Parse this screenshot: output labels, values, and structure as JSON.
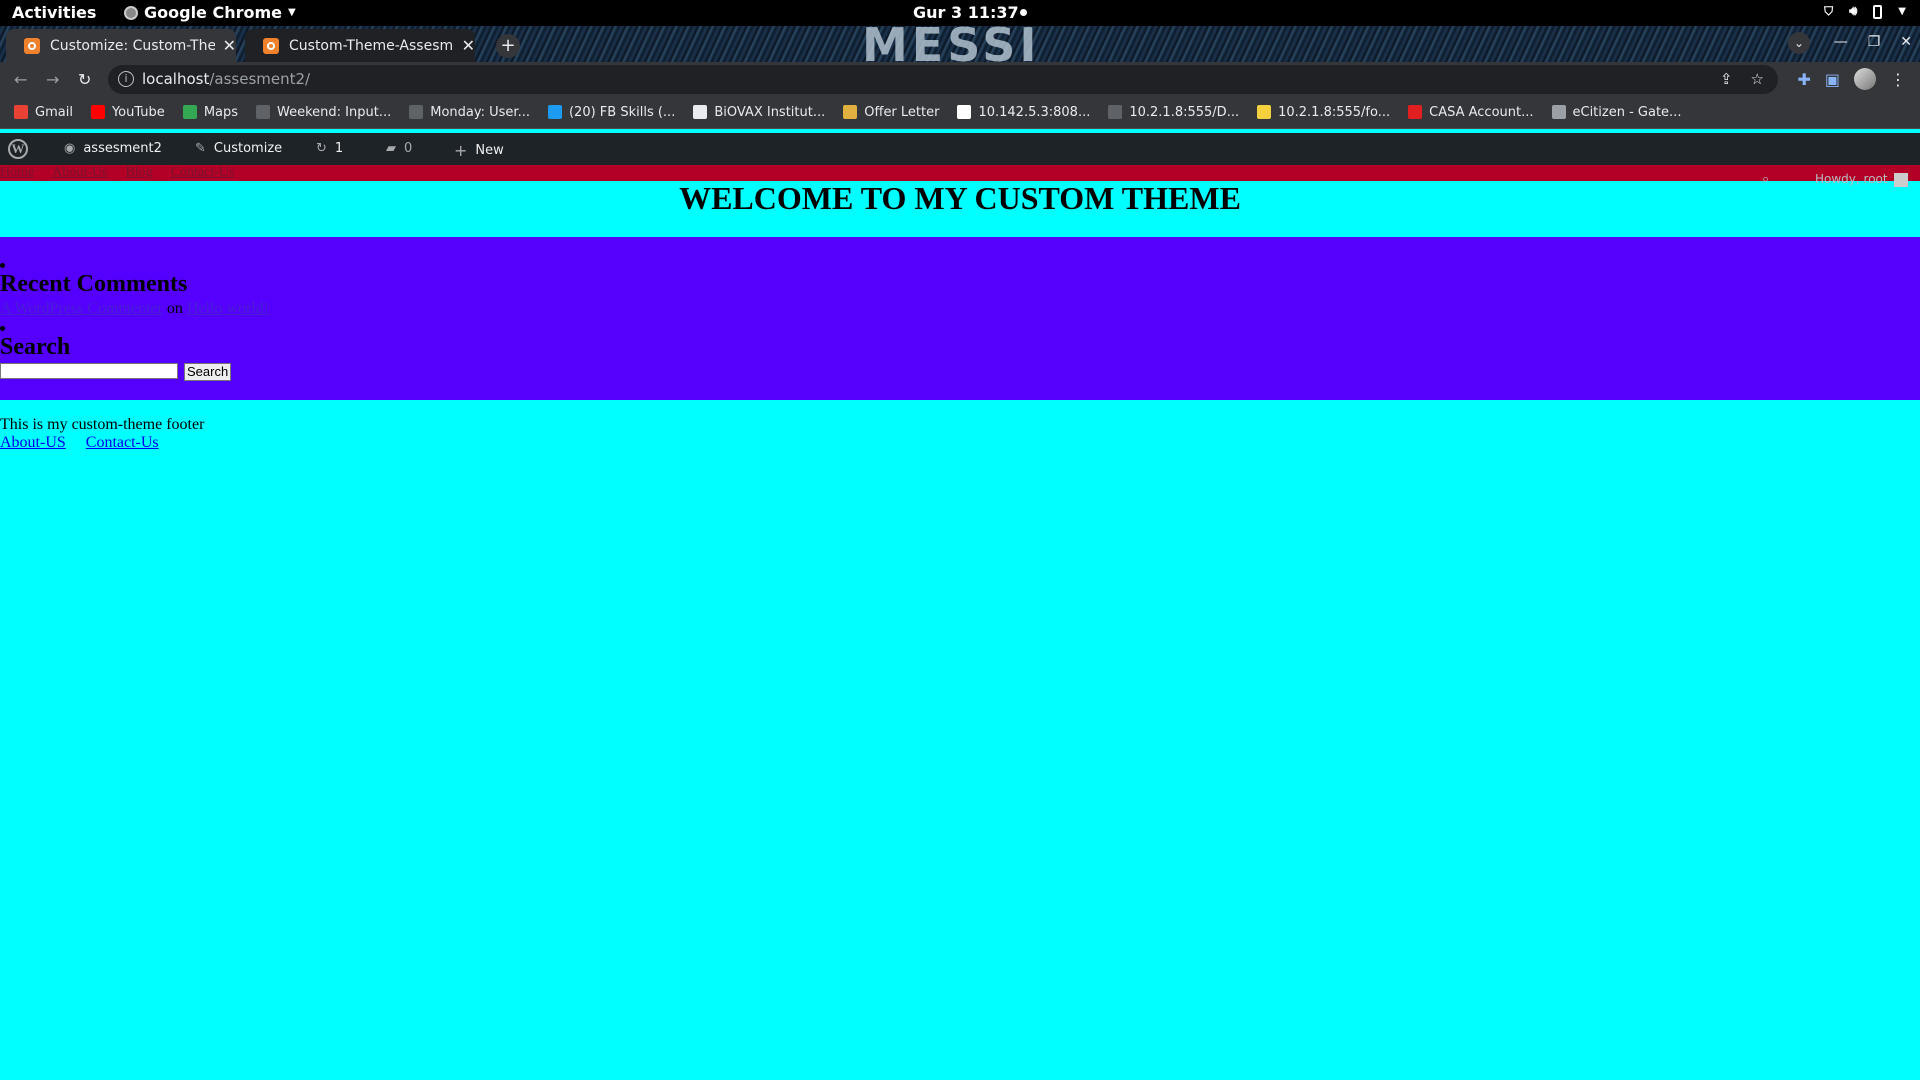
{
  "system_bar": {
    "activities": "Activities",
    "app_name": "Google Chrome",
    "clock": "Gur 3 11:37"
  },
  "browser": {
    "tabs": [
      {
        "title": "Customize: Custom-Theme-Assesment",
        "active": true
      },
      {
        "title": "Custom-Theme-Assesment",
        "active": false
      }
    ],
    "watermark": "MESSI",
    "url_host": "localhost",
    "url_path": "/assesment2/",
    "bookmarks": [
      {
        "label": "Gmail",
        "icon": "gmail-icon",
        "color": "#ea4335"
      },
      {
        "label": "YouTube",
        "icon": "youtube-icon",
        "color": "#ff0000"
      },
      {
        "label": "Maps",
        "icon": "maps-icon",
        "color": "#34a853"
      },
      {
        "label": "Weekend: Input...",
        "icon": "palm-icon",
        "color": "#5f6368"
      },
      {
        "label": "Monday: User...",
        "icon": "palm-icon",
        "color": "#5f6368"
      },
      {
        "label": "(20) FB Skills (...",
        "icon": "twitter-icon",
        "color": "#1d9bf0"
      },
      {
        "label": "BiOVAX Institut...",
        "icon": "people-icon",
        "color": "#e8eaed"
      },
      {
        "label": "Offer Letter",
        "icon": "briefcase-icon",
        "color": "#e0b040"
      },
      {
        "label": "10.142.5.3:808...",
        "icon": "page-icon",
        "color": "#ffffff"
      },
      {
        "label": "10.2.1.8:555/D...",
        "icon": "globe-icon",
        "color": "#5f6368"
      },
      {
        "label": "10.2.1.8:555/fo...",
        "icon": "page-icon",
        "color": "#f4d03f"
      },
      {
        "label": "CASA Account...",
        "icon": "casa-icon",
        "color": "#e02020"
      },
      {
        "label": "eCitizen - Gate...",
        "icon": "ecitizen-icon",
        "color": "#9aa0a6"
      }
    ]
  },
  "wp_admin_bar": {
    "site_name": "assesment2",
    "customize": "Customize",
    "updates": "1",
    "comments": "0",
    "new": "New",
    "howdy": "Howdy, root"
  },
  "page": {
    "nav": [
      "Home",
      "About-Us",
      "Blog",
      "Contact-Us"
    ],
    "title": "WELCOME TO MY CUSTOM THEME",
    "widgets": {
      "recent_comments_title": "Recent Comments",
      "comment_author": "A WordPress Commenter",
      "comment_on": "on",
      "comment_post": "Hello world!",
      "search_title": "Search",
      "search_button": "Search"
    },
    "footer": {
      "text": "This is my custom-theme footer",
      "links": [
        "About-US",
        "Contact-Us"
      ]
    },
    "colors": {
      "background": "#00ffff",
      "sidebar": "#5500ff",
      "nav": "#b30026"
    }
  }
}
